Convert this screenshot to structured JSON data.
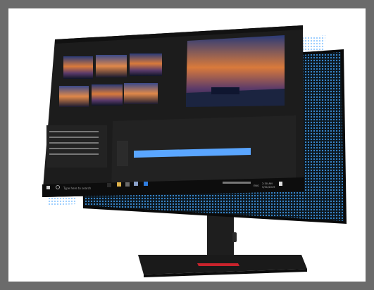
{
  "screen": {
    "search_placeholder": "Type here to search",
    "clock_time": "2:30 AM",
    "clock_date": "5/31/2019",
    "lang": "ENG"
  },
  "colors": {
    "background": "#6b6b6b",
    "panel": "#1c1c1c",
    "accent_blue": "#5aa6ff",
    "dot_blue": "#3b8fd9",
    "stand_red": "#c8232c"
  },
  "icons": [
    "windows-icon",
    "search-icon",
    "taskbar-app-icons",
    "tray-icons"
  ]
}
